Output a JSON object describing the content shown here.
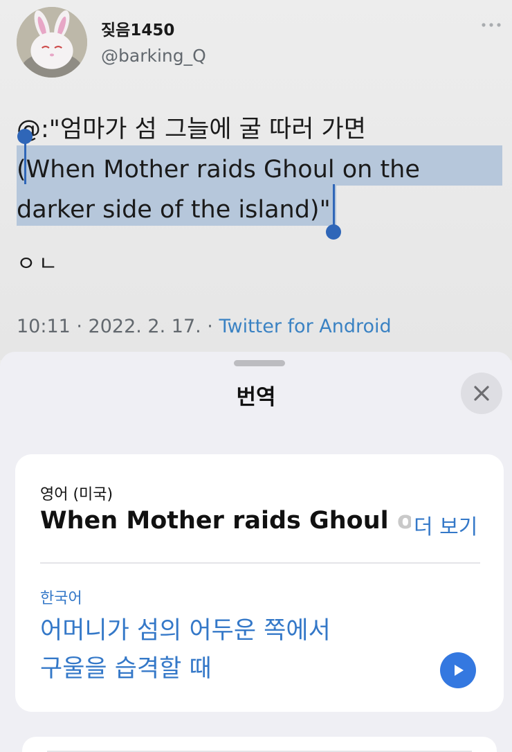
{
  "tweet": {
    "display_name": "짖음1450",
    "handle": "@barking_Q",
    "more_icon": "ellipsis-icon",
    "body_line1": "@:\"엄마가 섬 그늘에 굴 따러 가면",
    "body_line2_open": "(",
    "body_line2_selected": "When Mother raids Ghoul on the",
    "body_line3_selected": "darker side of the island",
    "body_line3_close": ")\"",
    "reply": "ㅇㄴ",
    "time_date": "10:11 · 2022. 2. 17. · ",
    "source": "Twitter for Android",
    "selection_color": "#b6c7db",
    "handle_color": "#2f66b8"
  },
  "sheet": {
    "title": "번역",
    "close_icon": "close-icon",
    "source_language": "영어 (미국)",
    "source_text": "When Mother raids Ghoul ",
    "source_text_faded": "on",
    "more_link": "더 보기",
    "target_language": "한국어",
    "target_line1": "어머니가 섬의 어두운 쪽에서",
    "target_line2": "구울을 습격할 때",
    "play_icon": "play-icon",
    "accent_color": "#3478c8"
  }
}
